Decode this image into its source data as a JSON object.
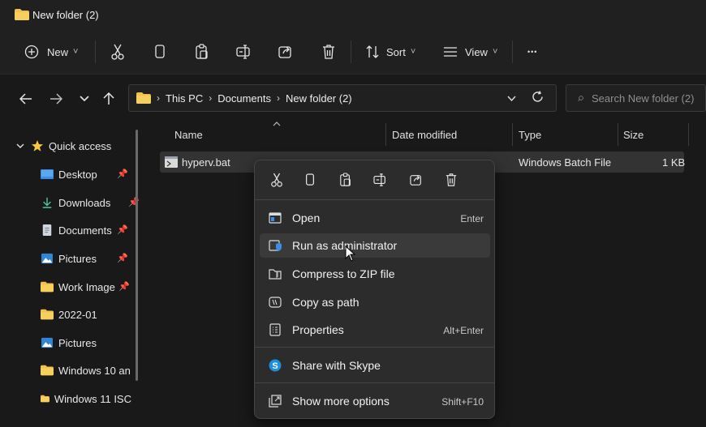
{
  "window": {
    "title": "New folder (2)"
  },
  "toolbar": {
    "new_label": "New",
    "sort_label": "Sort",
    "view_label": "View",
    "more_label": "•••",
    "caret": "˅"
  },
  "address": {
    "crumbs": [
      "This PC",
      "Documents",
      "New folder (2)"
    ],
    "separator": "›"
  },
  "search": {
    "placeholder": "Search New folder (2)"
  },
  "sidebar": {
    "quick_access": "Quick access",
    "items": [
      {
        "label": "Desktop",
        "icon": "desktop-icon",
        "pinned": true
      },
      {
        "label": "Downloads",
        "icon": "download-icon",
        "pinned": true
      },
      {
        "label": "Documents",
        "icon": "document-icon",
        "pinned": true
      },
      {
        "label": "Pictures",
        "icon": "pictures-icon",
        "pinned": true
      },
      {
        "label": "Work Image",
        "icon": "folder-icon",
        "pinned": true
      },
      {
        "label": "2022-01",
        "icon": "folder-icon",
        "pinned": false
      },
      {
        "label": "Pictures",
        "icon": "pictures-icon",
        "pinned": false
      },
      {
        "label": "Windows 10 an",
        "icon": "folder-icon",
        "pinned": false
      },
      {
        "label": "Windows 11 ISC",
        "icon": "folder-icon",
        "pinned": false
      }
    ]
  },
  "columns": {
    "name": "Name",
    "date_modified": "Date modified",
    "type": "Type",
    "size": "Size"
  },
  "files": [
    {
      "name": "hyperv.bat",
      "type": "Windows Batch File",
      "size": "1 KB"
    }
  ],
  "context_menu": {
    "items": [
      {
        "label": "Open",
        "shortcut": "Enter",
        "icon": "open-icon"
      },
      {
        "label": "Run as administrator",
        "shortcut": "",
        "icon": "shield-icon"
      },
      {
        "label": "Compress to ZIP file",
        "shortcut": "",
        "icon": "zip-icon"
      },
      {
        "label": "Copy as path",
        "shortcut": "",
        "icon": "path-icon"
      },
      {
        "label": "Properties",
        "shortcut": "Alt+Enter",
        "icon": "properties-icon"
      },
      {
        "label": "Share with Skype",
        "shortcut": "",
        "icon": "skype-icon"
      },
      {
        "label": "Show more options",
        "shortcut": "Shift+F10",
        "icon": "more-options-icon"
      }
    ]
  },
  "colors": {
    "accent_folder": "#f2c14e",
    "skype": "#1b8fdb",
    "blue": "#3b8ee8"
  }
}
